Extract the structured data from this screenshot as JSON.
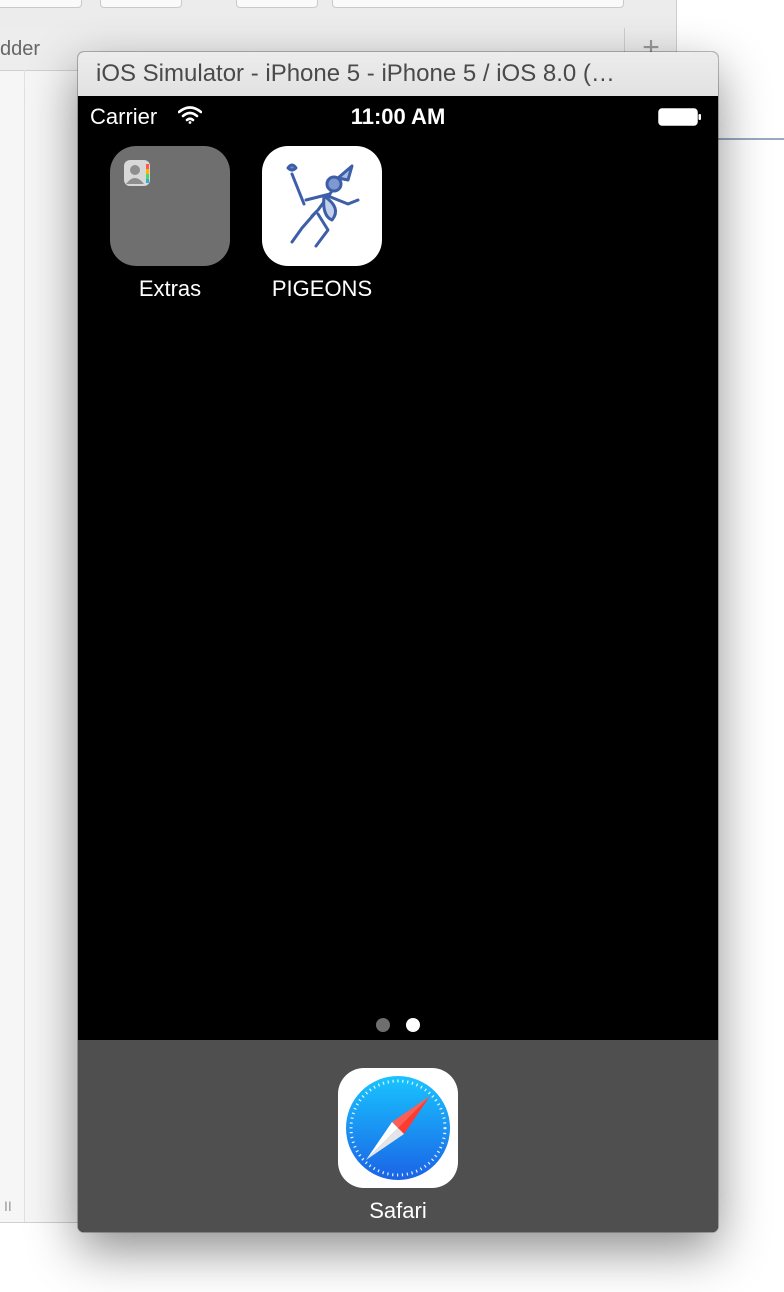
{
  "background_window": {
    "tab_text": "dder",
    "plus_label": "+",
    "bottom_glyph": "II"
  },
  "simulator": {
    "title": "iOS Simulator - iPhone 5 - iPhone 5 / iOS 8.0 (…"
  },
  "status_bar": {
    "carrier": "Carrier",
    "time": "11:00 AM"
  },
  "home_apps": [
    {
      "label": "Extras",
      "icon": "folder-icon"
    },
    {
      "label": "PIGEONS",
      "icon": "hermes-icon"
    }
  ],
  "page_indicator": {
    "pages": 2,
    "current": 2
  },
  "dock": {
    "apps": [
      {
        "label": "Safari",
        "icon": "compass-icon"
      }
    ]
  },
  "colors": {
    "screen": "#000000",
    "dock": "#4f4f4f",
    "folder": "#6f6f6f",
    "safari_blue": "#1a8cff"
  }
}
